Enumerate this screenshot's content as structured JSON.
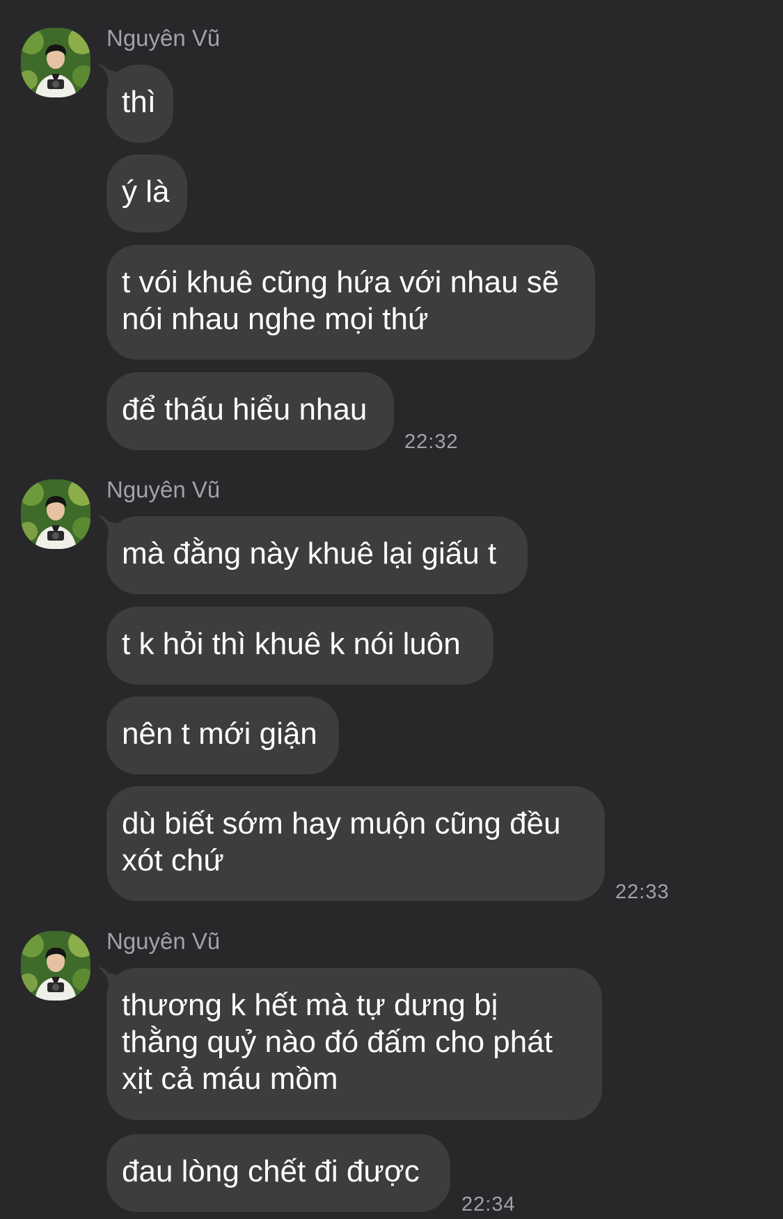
{
  "groups": [
    {
      "sender": "Nguyên Vũ",
      "messages": [
        "thì",
        "ý là",
        "t vói khuê cũng hứa với nhau sẽ\nnói nhau nghe mọi thứ",
        "để thấu hiểu nhau"
      ],
      "time": "22:32"
    },
    {
      "sender": "Nguyên Vũ",
      "messages": [
        "mà đằng này khuê lại giấu t",
        "t k hỏi thì khuê k nói luôn",
        "nên t mới giận",
        "dù biết sớm hay muộn cũng đều\nxót chứ"
      ],
      "time": "22:33"
    },
    {
      "sender": "Nguyên Vũ",
      "messages": [
        "thương k hết mà tự dưng bị\nthằng quỷ nào đó đấm cho phát\nxịt cả máu mồm",
        "đau lòng chết đi được"
      ],
      "time": "22:34"
    }
  ],
  "colors": {
    "background": "#28282a",
    "bubble": "#3d3d40",
    "text": "#ffffff",
    "meta": "#a2a2a7"
  },
  "icons": {
    "avatar": "user-avatar-photo"
  }
}
